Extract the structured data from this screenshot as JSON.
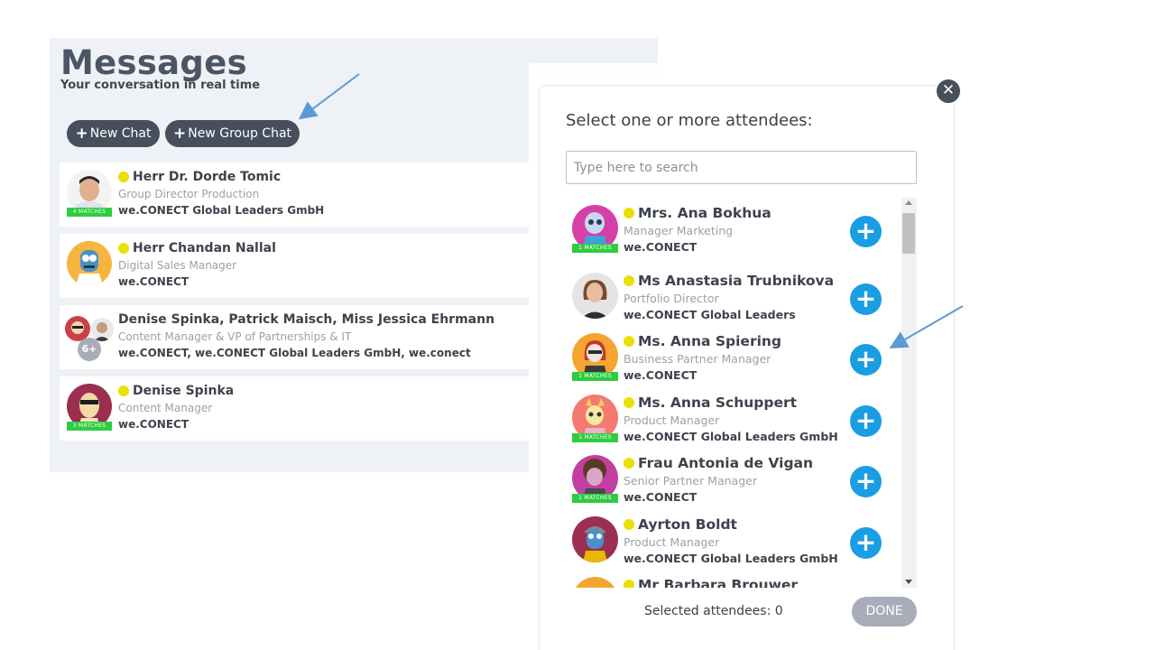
{
  "messages": {
    "title": "Messages",
    "subtitle": "Your conversation in real time",
    "new_chat_label": "New Chat",
    "new_group_chat_label": "New Group Chat",
    "chats": [
      {
        "name": "Herr Dr. Dorde Tomic",
        "role": "Group Director Production",
        "org": "we.CONECT Global Leaders GmbH",
        "badge": "4 MATCHES",
        "online": true
      },
      {
        "name": "Herr Chandan Nallal",
        "role": "Digital Sales Manager",
        "org": "we.CONECT",
        "badge": "",
        "online": true
      },
      {
        "name": "Denise Spinka, Patrick Maisch, Miss Jessica Ehrmann",
        "role": "Content Manager & VP of Partnerships & IT",
        "org": "we.CONECT, we.CONECT Global Leaders GmbH, we.conect",
        "extra_count": "6+",
        "online": false
      },
      {
        "name": "Denise Spinka",
        "role": "Content Manager",
        "org": "we.CONECT",
        "badge": "3 MATCHES",
        "online": true
      }
    ]
  },
  "modal": {
    "title": "Select one or more attendees:",
    "search_placeholder": "Type here to search",
    "selected_label": "Selected attendees: 0",
    "done_label": "DONE",
    "attendees": [
      {
        "name": "Mrs. Ana Bokhua",
        "role": "Manager Marketing",
        "org": "we.CONECT",
        "badge": "1 MATCHES"
      },
      {
        "name": "Ms Anastasia Trubnikova",
        "role": "Portfolio Director",
        "org": "we.CONECT Global Leaders",
        "badge": ""
      },
      {
        "name": "Ms. Anna Spiering",
        "role": "Business Partner Manager",
        "org": "we.CONECT",
        "badge": "1 MATCHES"
      },
      {
        "name": "Ms. Anna Schuppert",
        "role": "Product Manager",
        "org": "we.CONECT Global Leaders GmbH",
        "badge": "1 MATCHES"
      },
      {
        "name": "Frau Antonia de Vigan",
        "role": "Senior Partner Manager",
        "org": "we.CONECT",
        "badge": "1 MATCHES"
      },
      {
        "name": "Ayrton Boldt",
        "role": "Product Manager",
        "org": "we.CONECT Global Leaders GmbH",
        "badge": ""
      },
      {
        "name": "Mr Barbara Brouwer",
        "role": "",
        "org": "",
        "badge": ""
      }
    ]
  },
  "icons": {
    "plus": "+",
    "close": "✕"
  },
  "colors": {
    "accent_blue": "#1a9ee3",
    "status_yellow": "#e8e000",
    "match_green": "#2ecc40",
    "dark_button": "#474e5c",
    "disabled_button": "#a8adb9",
    "annotation_arrow": "#5b9bd5"
  }
}
